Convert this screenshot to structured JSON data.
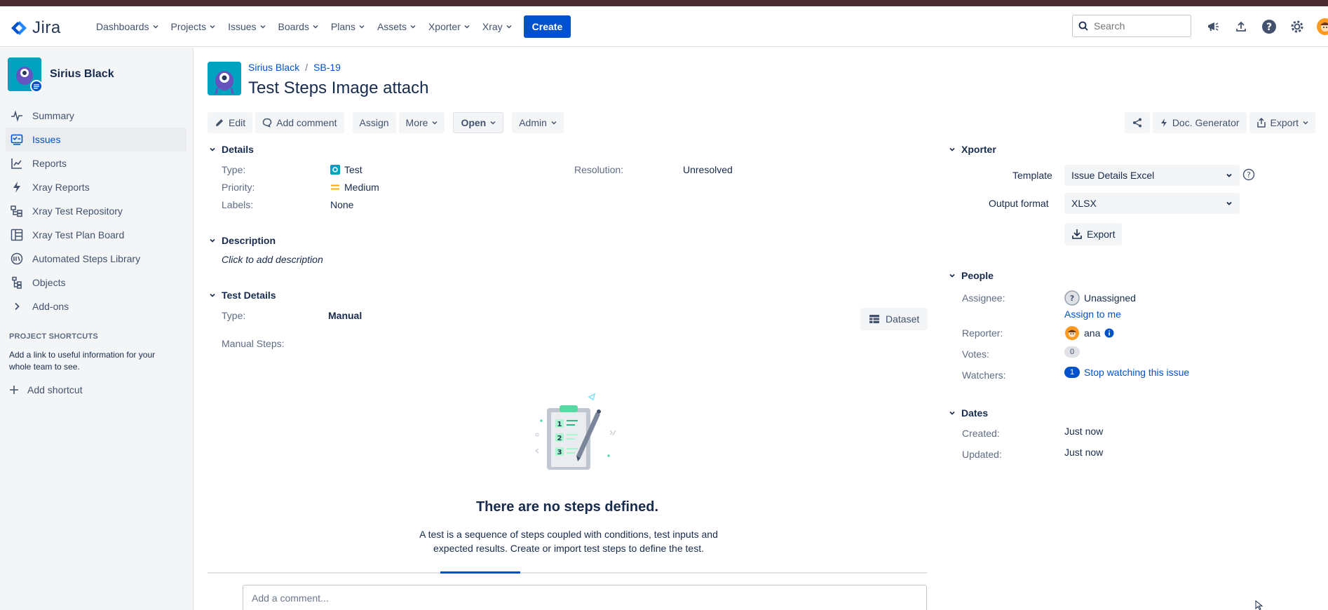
{
  "app": {
    "logo_text": "Jira"
  },
  "nav": {
    "items": [
      {
        "label": "Dashboards"
      },
      {
        "label": "Projects"
      },
      {
        "label": "Issues"
      },
      {
        "label": "Boards"
      },
      {
        "label": "Plans"
      },
      {
        "label": "Assets"
      },
      {
        "label": "Xporter"
      },
      {
        "label": "Xray"
      }
    ],
    "create_label": "Create",
    "search_placeholder": "Search"
  },
  "sidebar": {
    "project_name": "Sirius Black",
    "items": [
      {
        "label": "Summary",
        "icon": "pulse-icon"
      },
      {
        "label": "Issues",
        "icon": "issues-icon",
        "active": true
      },
      {
        "label": "Reports",
        "icon": "chart-icon"
      },
      {
        "label": "Xray Reports",
        "icon": "bolt-icon"
      },
      {
        "label": "Xray Test Repository",
        "icon": "repository-icon"
      },
      {
        "label": "Xray Test Plan Board",
        "icon": "board-icon"
      },
      {
        "label": "Automated Steps Library",
        "icon": "library-icon"
      },
      {
        "label": "Objects",
        "icon": "objects-icon"
      },
      {
        "label": "Add-ons",
        "icon": "chevron-right-icon"
      }
    ],
    "shortcuts_title": "PROJECT SHORTCUTS",
    "shortcuts_desc": "Add a link to useful information for your whole team to see.",
    "add_shortcut": "Add shortcut"
  },
  "issue": {
    "breadcrumb_project": "Sirius Black",
    "breadcrumb_sep": "/",
    "breadcrumb_key": "SB-19",
    "title": "Test Steps Image attach"
  },
  "toolbar": {
    "edit": "Edit",
    "add_comment": "Add comment",
    "assign": "Assign",
    "more": "More",
    "open": "Open",
    "admin": "Admin",
    "doc_generator": "Doc. Generator",
    "export": "Export"
  },
  "details": {
    "heading": "Details",
    "type_label": "Type:",
    "type_value": "Test",
    "priority_label": "Priority:",
    "priority_value": "Medium",
    "labels_label": "Labels:",
    "labels_value": "None",
    "resolution_label": "Resolution:",
    "resolution_value": "Unresolved"
  },
  "description": {
    "heading": "Description",
    "placeholder": "Click to add description"
  },
  "test_details": {
    "heading": "Test Details",
    "type_label": "Type:",
    "type_value": "Manual",
    "dataset_label": "Dataset",
    "manual_steps_label": "Manual Steps:",
    "empty_title": "There are no steps defined.",
    "empty_desc": "A test is a sequence of steps coupled with conditions, test inputs and expected results. Create or import test steps to define the test.",
    "illus_numbers": [
      "1",
      "2",
      "3"
    ]
  },
  "comment": {
    "placeholder": "Add a comment..."
  },
  "xporter": {
    "heading": "Xporter",
    "template_label": "Template",
    "template_value": "Issue Details Excel",
    "output_label": "Output format",
    "output_value": "XLSX",
    "export_label": "Export"
  },
  "people": {
    "heading": "People",
    "assignee_label": "Assignee:",
    "assignee_value": "Unassigned",
    "assign_to_me": "Assign to me",
    "reporter_label": "Reporter:",
    "reporter_value": "ana",
    "votes_label": "Votes:",
    "votes_value": "0",
    "watchers_label": "Watchers:",
    "watchers_count": "1",
    "watchers_action": "Stop watching this issue"
  },
  "dates": {
    "heading": "Dates",
    "created_label": "Created:",
    "created_value": "Just now",
    "updated_label": "Updated:",
    "updated_value": "Just now"
  },
  "colors": {
    "brand": "#0052cc",
    "accent_teal": "#00a3bf",
    "priority": "#ffab00"
  }
}
